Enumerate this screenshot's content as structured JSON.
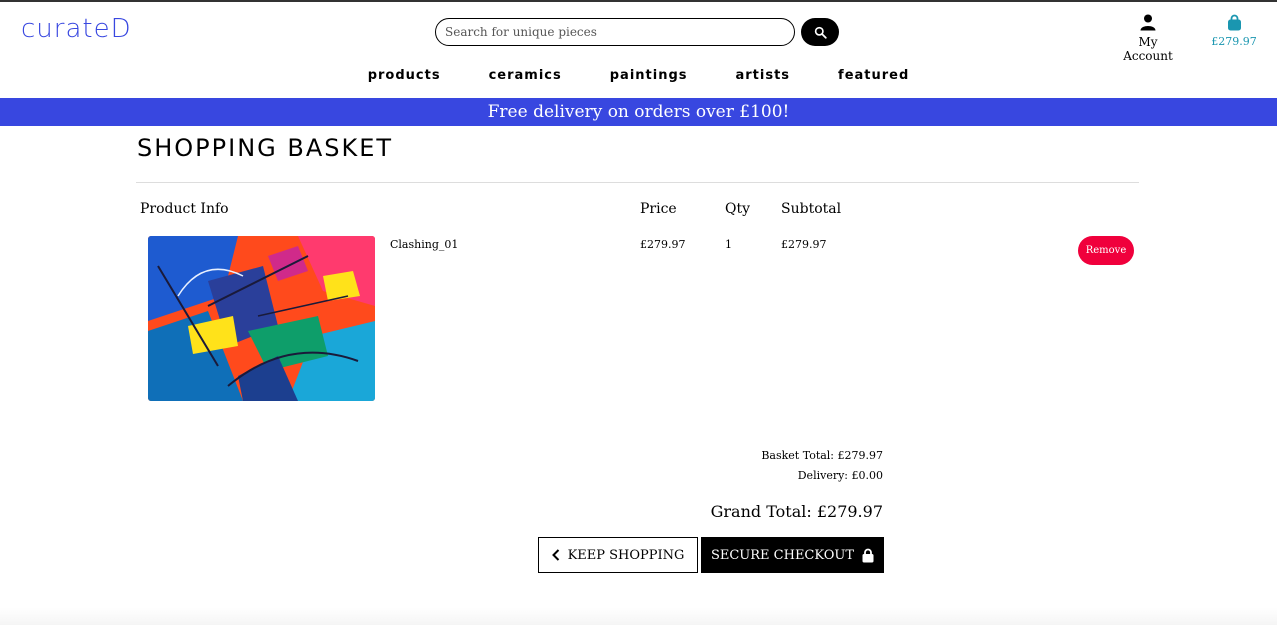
{
  "brand": {
    "logo": "curateD",
    "color": "#3847e0"
  },
  "search": {
    "placeholder": "Search for unique pieces",
    "icon": "search-icon"
  },
  "account": {
    "label": "My Account",
    "icon": "user-icon"
  },
  "basket_widget": {
    "total": "£279.97",
    "icon": "shopping-bag-icon",
    "color": "#1a96b0"
  },
  "nav": [
    "products",
    "ceramics",
    "paintings",
    "artists",
    "featured"
  ],
  "banner": {
    "text": "Free delivery on orders over £100!",
    "color": "#3847e0"
  },
  "page": {
    "title": "Shopping Basket"
  },
  "table": {
    "headers": {
      "product": "Product Info",
      "price": "Price",
      "qty": "Qty",
      "subtotal": "Subtotal"
    },
    "rows": [
      {
        "name": "Clashing_01",
        "price": "£279.97",
        "qty": "1",
        "subtotal": "£279.97",
        "remove": "Remove"
      }
    ]
  },
  "totals": {
    "basket": "Basket Total: £279.97",
    "delivery": "Delivery: £0.00",
    "grand": "Grand Total: £279.97"
  },
  "buttons": {
    "keep_shopping": "KEEP SHOPPING",
    "checkout": "SECURE CHECKOUT"
  },
  "colors": {
    "remove": "#f0003c",
    "checkout": "#000000"
  }
}
